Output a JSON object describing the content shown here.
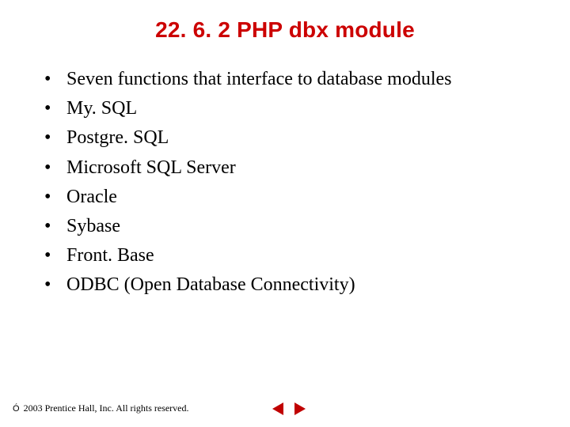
{
  "title": {
    "section": "22. 6. 2 PHP",
    "tail": " dbx module"
  },
  "bullets": [
    "Seven functions that interface to database modules",
    "My. SQL",
    "Postgre. SQL",
    "Microsoft SQL Server",
    "Oracle",
    "Sybase",
    "Front. Base",
    "ODBC (Open Database Connectivity)"
  ],
  "footer": {
    "copyright_symbol": "Ó",
    "text": " 2003 Prentice Hall, Inc.  All rights reserved."
  },
  "colors": {
    "title": "#cc0000",
    "nav_prev": "#c00000",
    "nav_next": "#c00000"
  }
}
